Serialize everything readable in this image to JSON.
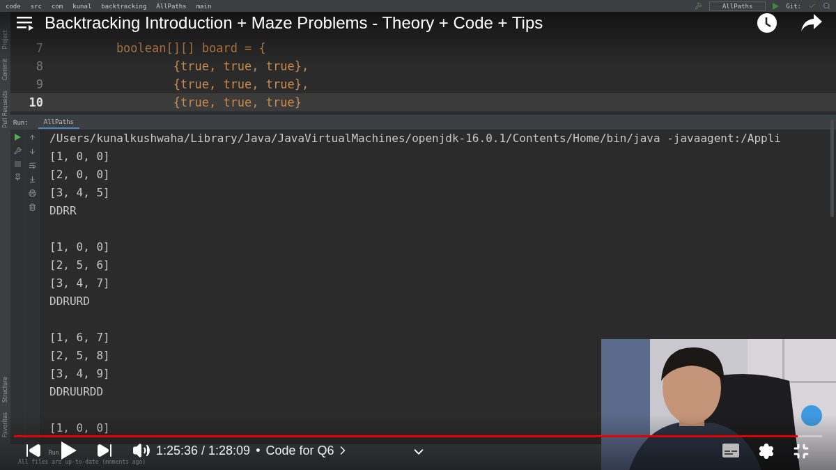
{
  "ide": {
    "breadcrumbs": [
      "code",
      "src",
      "com",
      "kunal",
      "backtracking",
      "AllPaths",
      "main"
    ],
    "run_config": "AllPaths",
    "vcs_label": "Git:",
    "tool_windows_top": [
      "Project",
      "Commit",
      "Pull Requests"
    ],
    "tool_windows_bottom": [
      "Structure",
      "Favorites"
    ],
    "editor": {
      "lines": [
        {
          "number": "7",
          "code": "        boolean[][] board = {",
          "current": false
        },
        {
          "number": "8",
          "code": "                {true, true, true},",
          "current": false
        },
        {
          "number": "9",
          "code": "                {true, true, true},",
          "current": false
        },
        {
          "number": "10",
          "code": "                {true, true, true}",
          "current": true
        }
      ]
    },
    "run_panel": {
      "label": "Run:",
      "tab": "AllPaths",
      "command": "/Users/kunalkushwaha/Library/Java/JavaVirtualMachines/openjdk-16.0.1/Contents/Home/bin/java -javaagent:/Appli",
      "outputs": [
        {
          "rows": [
            "[1, 0, 0]",
            "[2, 0, 0]",
            "[3, 4, 5]"
          ],
          "path": "DDRR"
        },
        {
          "rows": [
            "[1, 0, 0]",
            "[2, 5, 6]",
            "[3, 4, 7]"
          ],
          "path": "DDRURD"
        },
        {
          "rows": [
            "[1, 6, 7]",
            "[2, 5, 8]",
            "[3, 4, 9]"
          ],
          "path": "DDRUURDD"
        },
        {
          "rows": [
            "[1, 0, 0]"
          ]
        }
      ]
    },
    "status_tabs": [
      "Run"
    ],
    "status_message": "All files are up-to-date (moments ago)"
  },
  "player": {
    "title": "Backtracking Introduction + Maze Problems - Theory + Code + Tips",
    "progress": {
      "level": 0.97
    },
    "playing": false,
    "time": "1:25:36 / 1:28:09",
    "separator": "•",
    "chapter": "Code for Q6"
  }
}
